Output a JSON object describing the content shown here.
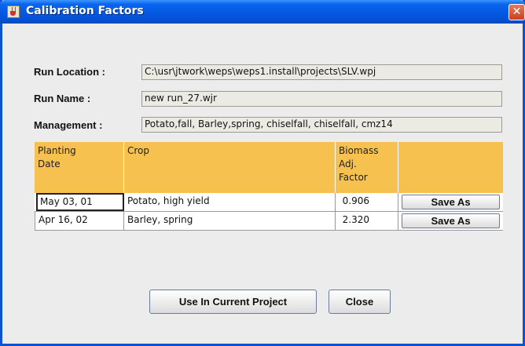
{
  "window": {
    "title": "Calibration Factors",
    "close_glyph": "✕"
  },
  "fields": {
    "run_location": {
      "label": "Run Location :",
      "value": "C:\\usr\\jtwork\\weps\\weps1.install\\projects\\SLV.wpj"
    },
    "run_name": {
      "label": "Run Name :",
      "value": "new run_27.wjr"
    },
    "management": {
      "label": "Management :",
      "value": "Potato,fall, Barley,spring, chiselfall, chiselfall, cmz14"
    }
  },
  "table": {
    "headers": [
      "Planting\nDate",
      "Crop",
      "Biomass\nAdj.\nFactor",
      ""
    ],
    "header_color": "#f6c14f",
    "rows": [
      {
        "date": "May 03, 01",
        "crop": "Potato, high yield",
        "factor": "0.906",
        "action": "Save As"
      },
      {
        "date": "Apr 16, 02",
        "crop": "Barley, spring",
        "factor": "2.320",
        "action": "Save As"
      }
    ]
  },
  "buttons": {
    "use_current": "Use In Current Project",
    "close": "Close"
  }
}
